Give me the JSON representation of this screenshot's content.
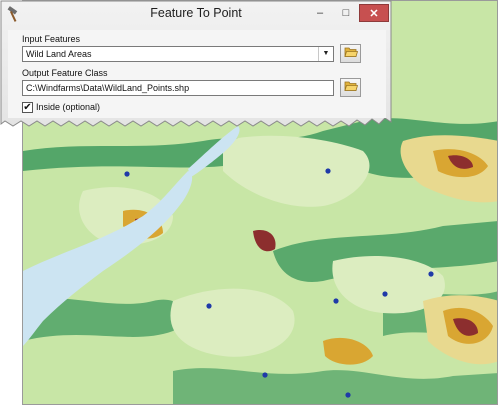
{
  "dialog": {
    "title": "Feature To Point",
    "window_buttons": {
      "minimize": "–",
      "maximize": "□",
      "close": "✕"
    },
    "input_features_label": "Input Features",
    "input_features_value": "Wild Land Areas",
    "output_class_label": "Output Feature Class",
    "output_class_value": "C:\\Windfarms\\Data\\WildLand_Points.shp",
    "inside_label": "Inside (optional)",
    "inside_checked": true,
    "checkmark": "✔",
    "icons": {
      "app": "hammer-icon",
      "browse": "folder-open-icon",
      "dropdown": "chevron-down-icon"
    }
  },
  "map": {
    "colors": {
      "water": "#cce4f2",
      "lowland": "#c8e6a6",
      "wildland": "#dcedc0",
      "forest": "#3f9a5e",
      "highland": "#e8d98f",
      "mountain": "#d9a632",
      "peak": "#8c2e2e",
      "point": "#1f3aa8"
    }
  }
}
